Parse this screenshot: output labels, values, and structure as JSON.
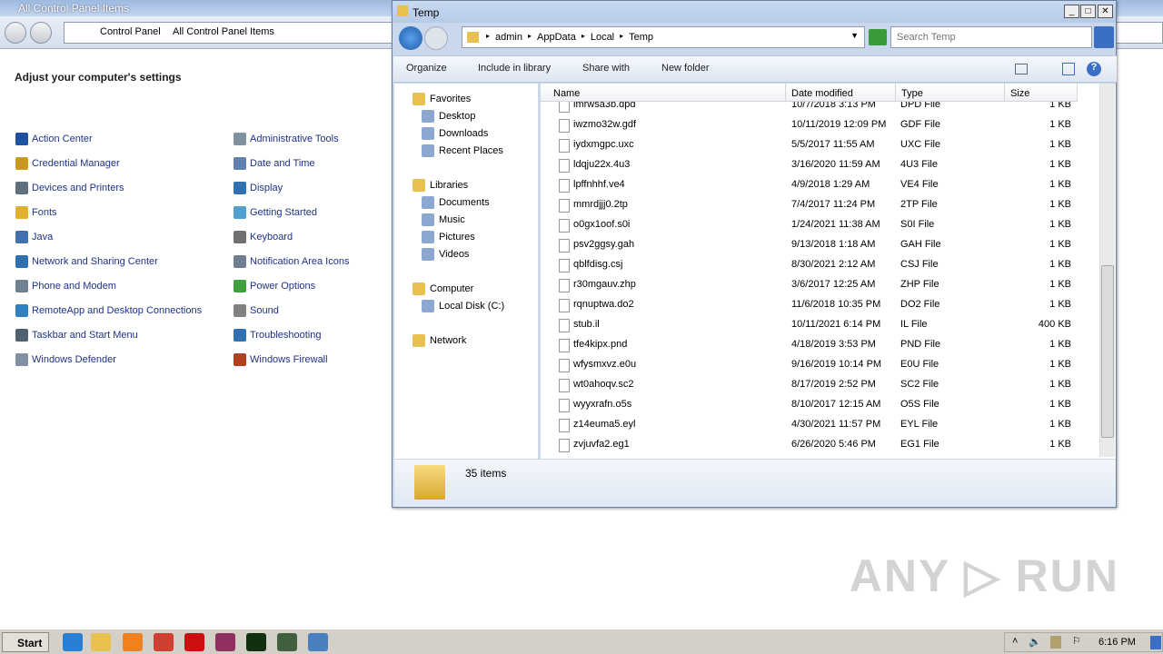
{
  "control_panel": {
    "title": "All Control Panel Items",
    "breadcrumb": [
      "Control Panel",
      "All Control Panel Items"
    ],
    "heading": "Adjust your computer's settings",
    "items_left": [
      {
        "label": "Action Center",
        "icon": "flag-icon",
        "color": "#2050a0"
      },
      {
        "label": "Credential Manager",
        "icon": "vault-icon",
        "color": "#c89a20"
      },
      {
        "label": "Devices and Printers",
        "icon": "printer-icon",
        "color": "#607080"
      },
      {
        "label": "Fonts",
        "icon": "fonts-folder-icon",
        "color": "#e0b030"
      },
      {
        "label": "Java",
        "icon": "java-icon",
        "color": "#4070b0"
      },
      {
        "label": "Network and Sharing Center",
        "icon": "network-icon",
        "color": "#3070b0"
      },
      {
        "label": "Phone and Modem",
        "icon": "phone-icon",
        "color": "#708090"
      },
      {
        "label": "RemoteApp and Desktop Connections",
        "icon": "remote-icon",
        "color": "#3080c0"
      },
      {
        "label": "Taskbar and Start Menu",
        "icon": "taskbar-icon",
        "color": "#506070"
      },
      {
        "label": "Windows Defender",
        "icon": "defender-icon",
        "color": "#8090a0"
      }
    ],
    "items_right": [
      {
        "label": "Administrative Tools",
        "icon": "admin-tools-icon",
        "color": "#8090a0"
      },
      {
        "label": "Date and Time",
        "icon": "clock-icon",
        "color": "#6080b0"
      },
      {
        "label": "Display",
        "icon": "monitor-icon",
        "color": "#3070b0"
      },
      {
        "label": "Getting Started",
        "icon": "getting-started-icon",
        "color": "#50a0d0"
      },
      {
        "label": "Keyboard",
        "icon": "keyboard-icon",
        "color": "#707070"
      },
      {
        "label": "Notification Area Icons",
        "icon": "notification-icon",
        "color": "#708090"
      },
      {
        "label": "Power Options",
        "icon": "power-icon",
        "color": "#40a040"
      },
      {
        "label": "Sound",
        "icon": "speaker-icon",
        "color": "#808080"
      },
      {
        "label": "Troubleshooting",
        "icon": "troubleshoot-icon",
        "color": "#3070b0"
      },
      {
        "label": "Windows Firewall",
        "icon": "firewall-icon",
        "color": "#b04020"
      }
    ]
  },
  "explorer": {
    "title": "Temp",
    "breadcrumb": [
      "admin",
      "AppData",
      "Local",
      "Temp"
    ],
    "search_placeholder": "Search Temp",
    "toolbar": {
      "organize": "Organize",
      "include": "Include in library",
      "share": "Share with",
      "new_folder": "New folder"
    },
    "nav": [
      {
        "label": "Favorites",
        "icon": "star-icon",
        "level": 0
      },
      {
        "label": "Desktop",
        "icon": "desktop-icon",
        "level": 1
      },
      {
        "label": "Downloads",
        "icon": "downloads-icon",
        "level": 1
      },
      {
        "label": "Recent Places",
        "icon": "recent-places-icon",
        "level": 1
      },
      {
        "label": "Libraries",
        "icon": "libraries-icon",
        "level": 0
      },
      {
        "label": "Documents",
        "icon": "documents-icon",
        "level": 1
      },
      {
        "label": "Music",
        "icon": "music-icon",
        "level": 1
      },
      {
        "label": "Pictures",
        "icon": "pictures-icon",
        "level": 1
      },
      {
        "label": "Videos",
        "icon": "videos-icon",
        "level": 1
      },
      {
        "label": "Computer",
        "icon": "computer-icon",
        "level": 0
      },
      {
        "label": "Local Disk (C:)",
        "icon": "disk-icon",
        "level": 1
      },
      {
        "label": "Network",
        "icon": "network-icon",
        "level": 0
      }
    ],
    "columns": [
      "Name",
      "Date modified",
      "Type",
      "Size"
    ],
    "files": [
      [
        "imrwsa3b.dpd",
        "10/7/2018 3:13 PM",
        "DPD File",
        "1 KB"
      ],
      [
        "iwzmo32w.gdf",
        "10/11/2019 12:09 PM",
        "GDF File",
        "1 KB"
      ],
      [
        "iydxmgpc.uxc",
        "5/5/2017 11:55 AM",
        "UXC File",
        "1 KB"
      ],
      [
        "ldqju22x.4u3",
        "3/16/2020 11:59 AM",
        "4U3 File",
        "1 KB"
      ],
      [
        "lpffnhhf.ve4",
        "4/9/2018 1:29 AM",
        "VE4 File",
        "1 KB"
      ],
      [
        "mmrdjjj0.2tp",
        "7/4/2017 11:24 PM",
        "2TP File",
        "1 KB"
      ],
      [
        "o0gx1oof.s0i",
        "1/24/2021 11:38 AM",
        "S0I File",
        "1 KB"
      ],
      [
        "psv2ggsy.gah",
        "9/13/2018 1:18 AM",
        "GAH File",
        "1 KB"
      ],
      [
        "qblfdisg.csj",
        "8/30/2021 2:12 AM",
        "CSJ File",
        "1 KB"
      ],
      [
        "r30mgauv.zhp",
        "3/6/2017 12:25 AM",
        "ZHP File",
        "1 KB"
      ],
      [
        "rqnuptwa.do2",
        "11/6/2018 10:35 PM",
        "DO2 File",
        "1 KB"
      ],
      [
        "stub.il",
        "10/11/2021 6:14 PM",
        "IL File",
        "400 KB"
      ],
      [
        "tfe4kipx.pnd",
        "4/18/2019 3:53 PM",
        "PND File",
        "1 KB"
      ],
      [
        "wfysmxvz.e0u",
        "9/16/2019 10:14 PM",
        "E0U File",
        "1 KB"
      ],
      [
        "wt0ahoqv.sc2",
        "8/17/2019 2:52 PM",
        "SC2 File",
        "1 KB"
      ],
      [
        "wyyxrafn.o5s",
        "8/10/2017 12:15 AM",
        "O5S File",
        "1 KB"
      ],
      [
        "z14euma5.eyl",
        "4/30/2021 11:57 PM",
        "EYL File",
        "1 KB"
      ],
      [
        "zvjuvfa2.eg1",
        "6/26/2020 5:46 PM",
        "EG1 File",
        "1 KB"
      ]
    ],
    "status": "35 items"
  },
  "taskbar": {
    "start": "Start",
    "clock": "6:16 PM",
    "apps": [
      {
        "icon": "ie-icon",
        "color": "#2a7fd4"
      },
      {
        "icon": "explorer-icon",
        "color": "#e8c050"
      },
      {
        "icon": "media-player-icon",
        "color": "#f08020"
      },
      {
        "icon": "chrome-icon",
        "color": "#d04030"
      },
      {
        "icon": "opera-icon",
        "color": "#cc1010"
      },
      {
        "icon": "winrar-icon",
        "color": "#903060"
      },
      {
        "icon": "hex-app-icon",
        "color": "#103010"
      },
      {
        "icon": "terminal-icon",
        "color": "#406040"
      },
      {
        "icon": "control-panel-icon",
        "color": "#4a80c0"
      }
    ]
  },
  "watermark": "ANY RUN"
}
